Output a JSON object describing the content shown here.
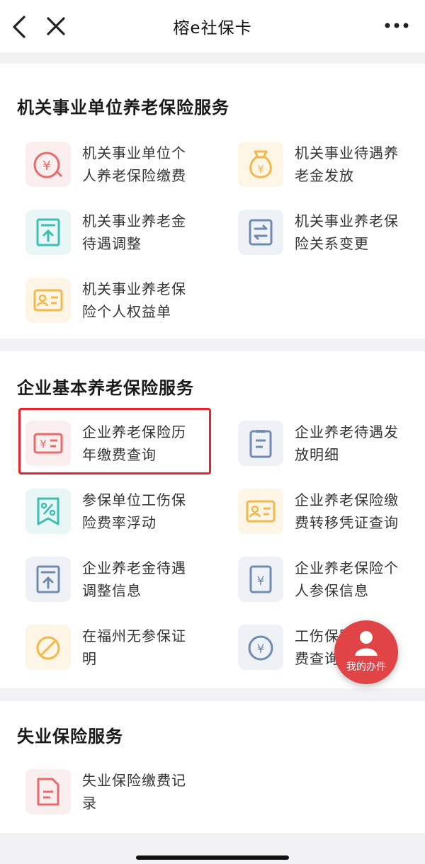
{
  "header": {
    "title": "榕e社保卡",
    "back_icon": "chevron-left-icon",
    "close_icon": "close-icon",
    "more_icon": "more-dots-icon"
  },
  "sections": [
    {
      "title": "机关事业单位养老保险服务",
      "items": [
        {
          "line1": "机关事业单位个",
          "line2": "人养老保险缴费",
          "icon": "yen-refresh-icon",
          "color": "#e86a6a"
        },
        {
          "line1": "机关事业待遇养",
          "line2": "老金发放",
          "icon": "money-bag-icon",
          "color": "#f2b84b"
        },
        {
          "line1": "机关事业养老金",
          "line2": "待遇调整",
          "icon": "upload-doc-icon",
          "color": "#3cbfb3"
        },
        {
          "line1": "机关事业养老保",
          "line2": "险关系变更",
          "icon": "transfer-arrows-icon",
          "color": "#6f8bb0"
        },
        {
          "line1": "机关事业养老保",
          "line2": "险个人权益单",
          "icon": "id-card-icon",
          "color": "#f2b84b"
        }
      ]
    },
    {
      "title": "企业基本养老保险服务",
      "items": [
        {
          "line1": "企业养老保险历",
          "line2": "年缴费查询",
          "icon": "yen-card-icon",
          "color": "#e86a6a"
        },
        {
          "line1": "企业养老待遇发",
          "line2": "放明细",
          "icon": "clipboard-list-icon",
          "color": "#6f8bb0"
        },
        {
          "line1": "参保单位工伤保",
          "line2": "险费率浮动",
          "icon": "percent-ribbon-icon",
          "color": "#3cbfb3"
        },
        {
          "line1": "企业养老保险缴",
          "line2": "费转移凭证查询",
          "icon": "id-card-icon",
          "color": "#f2b84b"
        },
        {
          "line1": "企业养老金待遇",
          "line2": "调整信息",
          "icon": "upload-doc-icon",
          "color": "#6f8bb0"
        },
        {
          "line1": "企业养老保险个",
          "line2": "人参保信息",
          "icon": "yen-doc-icon",
          "color": "#6f8bb0"
        },
        {
          "line1": "在福州无参保证",
          "line2": "明",
          "icon": "no-sign-icon",
          "color": "#f2b84b"
        },
        {
          "line1": "工伤保险缴",
          "line2": "费查询",
          "icon": "yen-refresh-icon",
          "color": "#6f8bb0"
        }
      ]
    },
    {
      "title": "失业保险服务",
      "items": [
        {
          "line1": "失业保险缴费记",
          "line2": "录",
          "icon": "document-icon",
          "color": "#e86a6a"
        }
      ]
    }
  ],
  "fab": {
    "label": "我的办件",
    "icon": "person-icon"
  }
}
